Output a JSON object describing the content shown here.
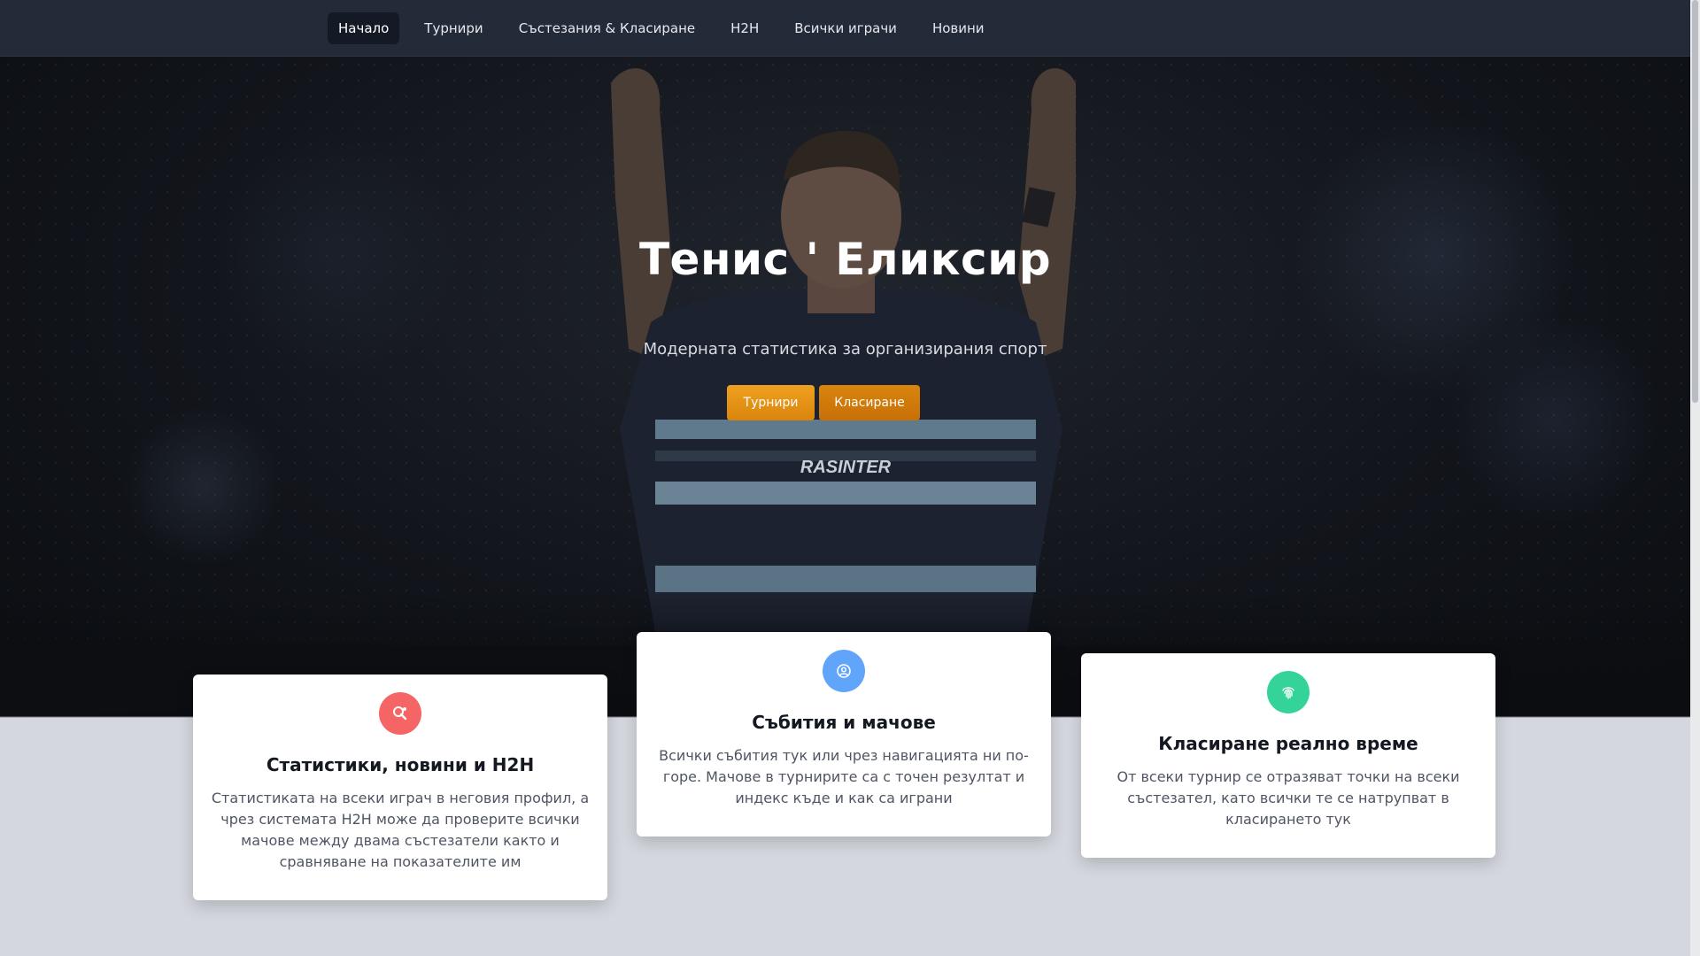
{
  "nav": {
    "items": [
      {
        "label": "Начало",
        "active": true
      },
      {
        "label": "Турнири"
      },
      {
        "label": "Състезания & Класиране"
      },
      {
        "label": "H2H"
      },
      {
        "label": "Всички играчи"
      },
      {
        "label": "Новини"
      }
    ]
  },
  "hero": {
    "title": "Тенис ' Еликсир",
    "subtitle": "Модерната статистика за организирания спорт",
    "buttons": {
      "tournaments": "Турнири",
      "ranking": "Класиране"
    },
    "jersey_text": "RASINTER"
  },
  "features": [
    {
      "icon": "ping-pong-icon",
      "color": "#f56565",
      "title": "Статистики, новини и H2H",
      "text": "Статистиката на всеки играч в неговия профил, а чрез системата H2H може да проверите всички мачове между двама състезатели както и сравняване на показателите им"
    },
    {
      "icon": "user-circle-icon",
      "color": "#60a5fa",
      "title": "Събития и мачове",
      "text": "Всички събития тук или чрез навигацията ни по-горе. Мачове в турнирите са с точен резултат и индекс къде и как са играни"
    },
    {
      "icon": "fingerprint-icon",
      "color": "#34d399",
      "title": "Класиране реално време",
      "text": "От всеки турнир се отразяват точки на всеки състезател, като всички те се натрупват в класирането тук"
    }
  ]
}
